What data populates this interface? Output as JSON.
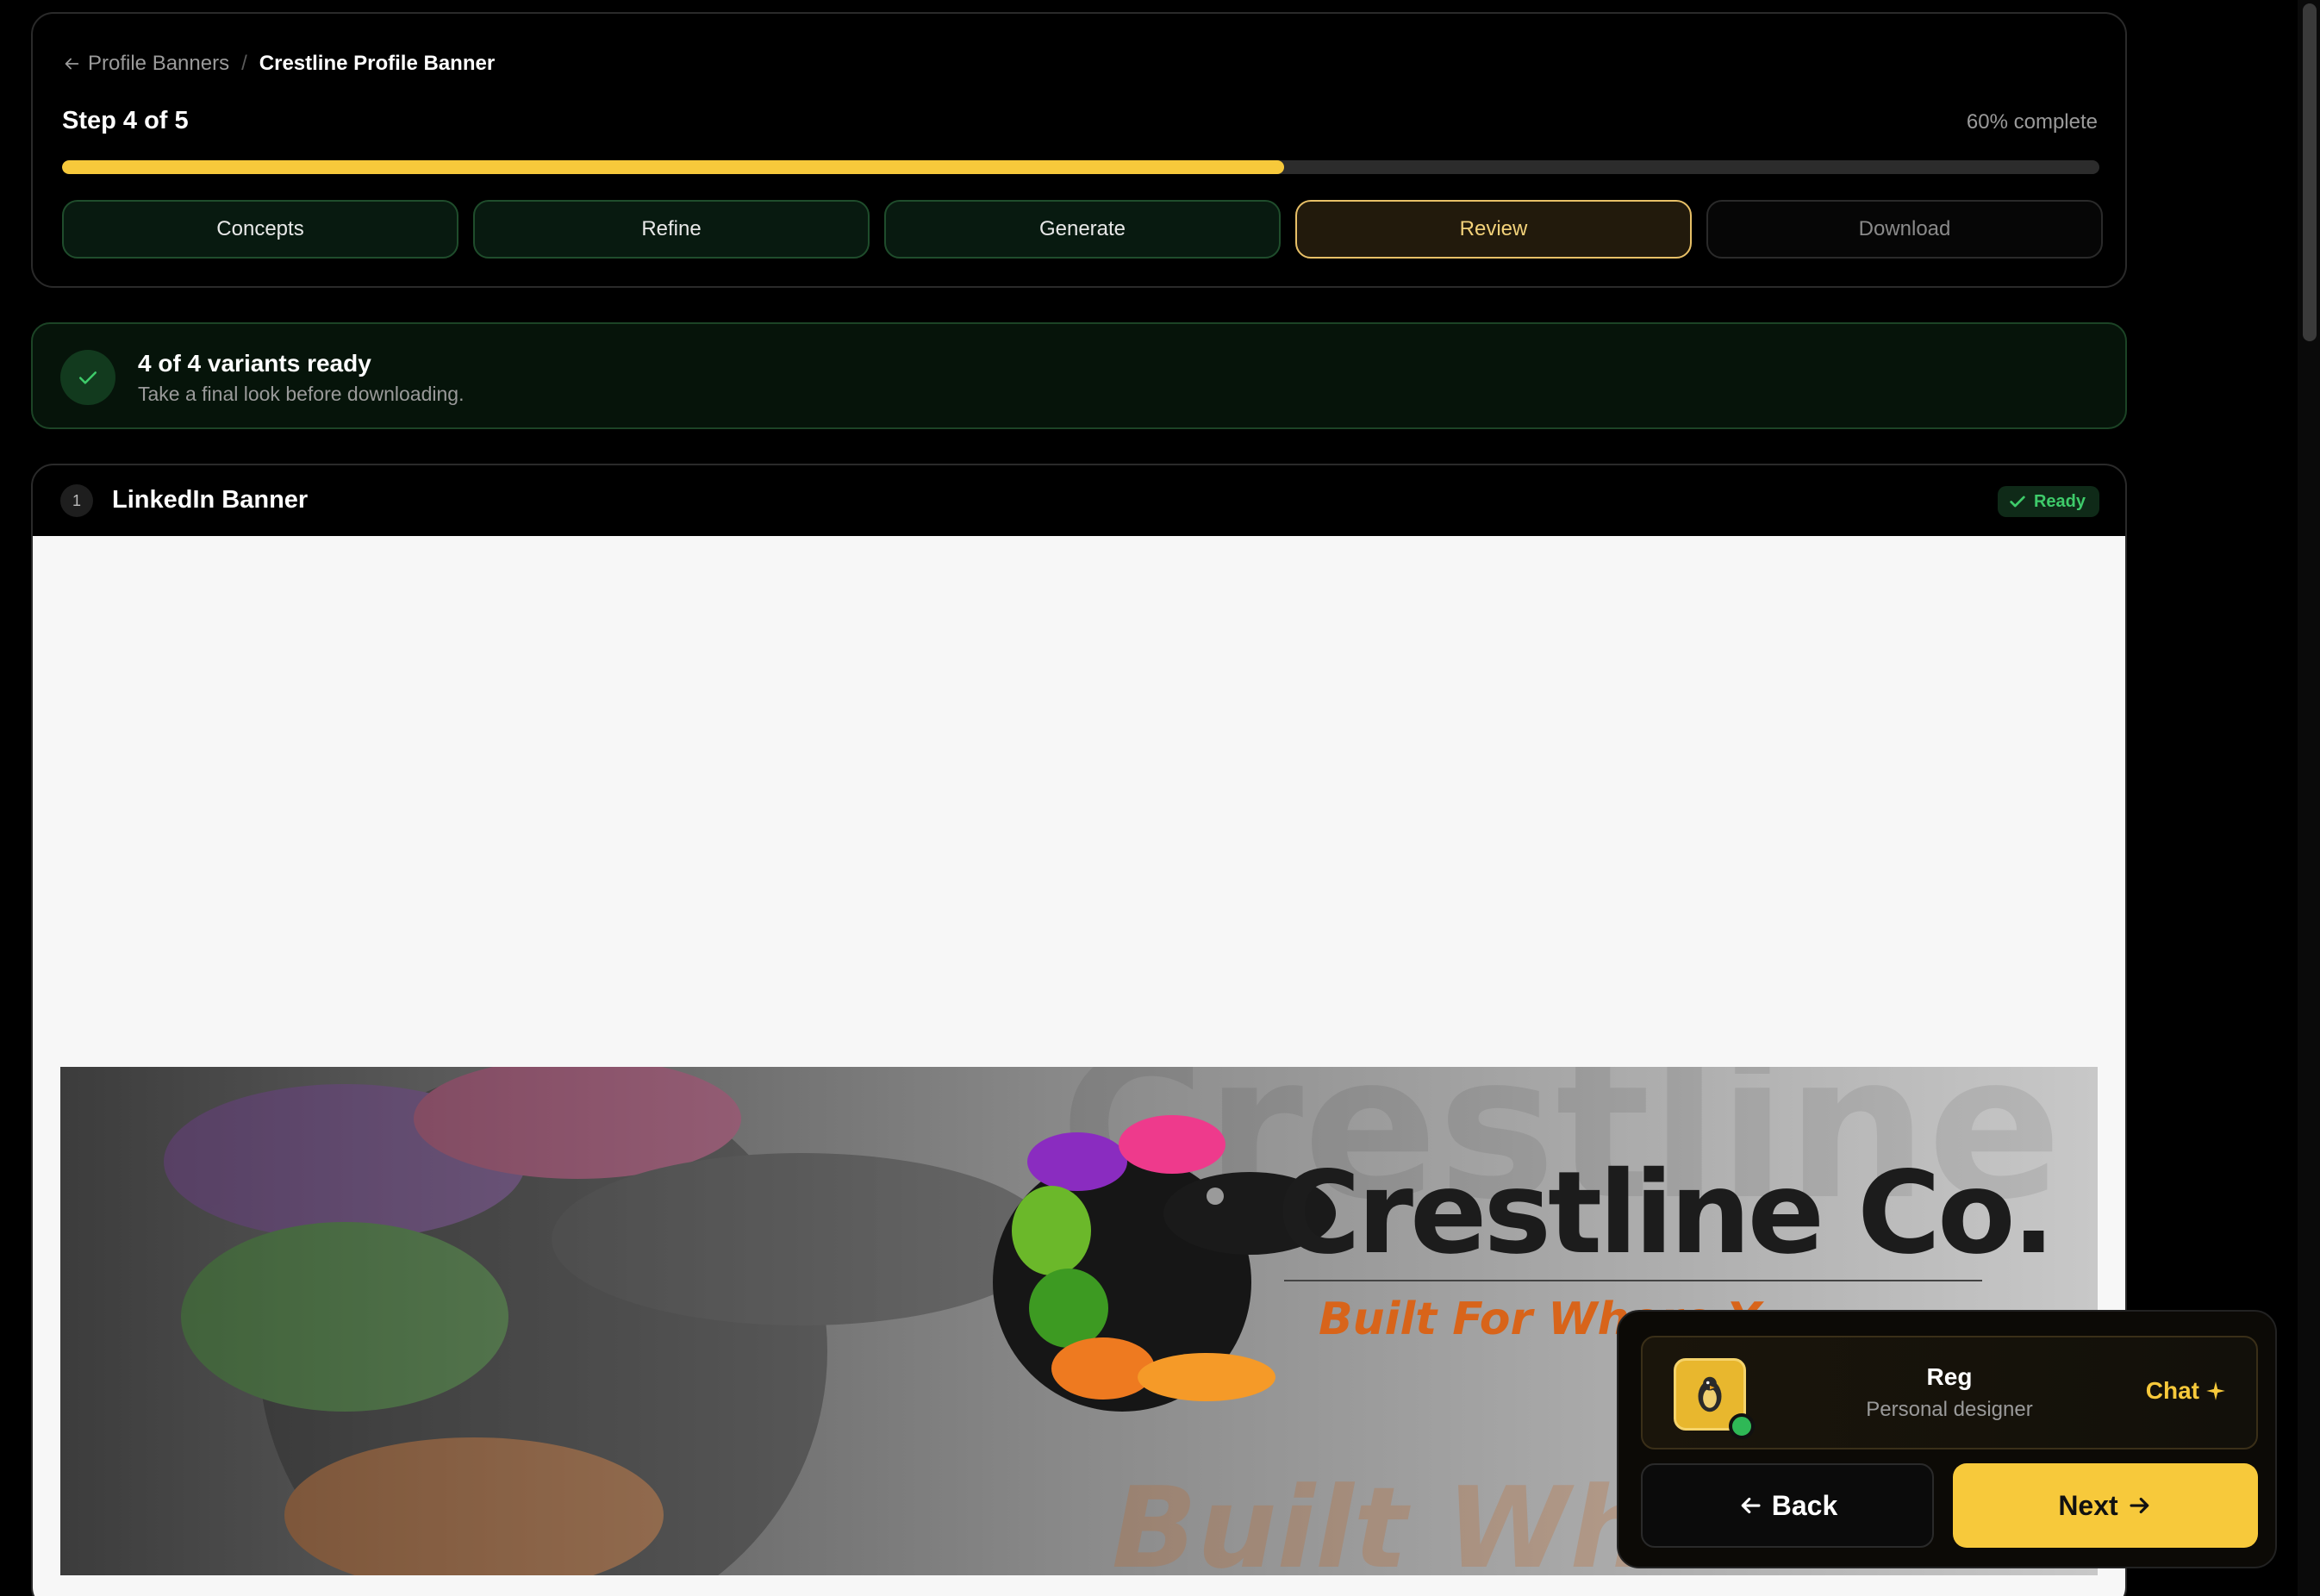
{
  "breadcrumb": {
    "parent": "Profile Banners",
    "current": "Crestline Profile Banner"
  },
  "progress": {
    "step_label": "Step 4 of 5",
    "percent_label": "60% complete",
    "percent": 60
  },
  "steps": [
    {
      "label": "Concepts",
      "state": "done"
    },
    {
      "label": "Refine",
      "state": "done"
    },
    {
      "label": "Generate",
      "state": "done"
    },
    {
      "label": "Review",
      "state": "active"
    },
    {
      "label": "Download",
      "state": "pending"
    }
  ],
  "status": {
    "title": "4 of 4 variants ready",
    "subtitle": "Take a final look before downloading."
  },
  "variant": {
    "number": "1",
    "title": "LinkedIn Banner",
    "badge": "Ready",
    "banner": {
      "brand": "Crestline Co.",
      "tagline": "Built For Where Y",
      "bg_text": "Crestline",
      "bg_tagline": "Built Wher"
    }
  },
  "assistant": {
    "name": "Reg",
    "role": "Personal designer",
    "chat_label": "Chat"
  },
  "nav": {
    "back_label": "Back",
    "next_label": "Next"
  },
  "colors": {
    "accent": "#f7c93b",
    "success": "#3ecb6a",
    "background": "#000000"
  }
}
